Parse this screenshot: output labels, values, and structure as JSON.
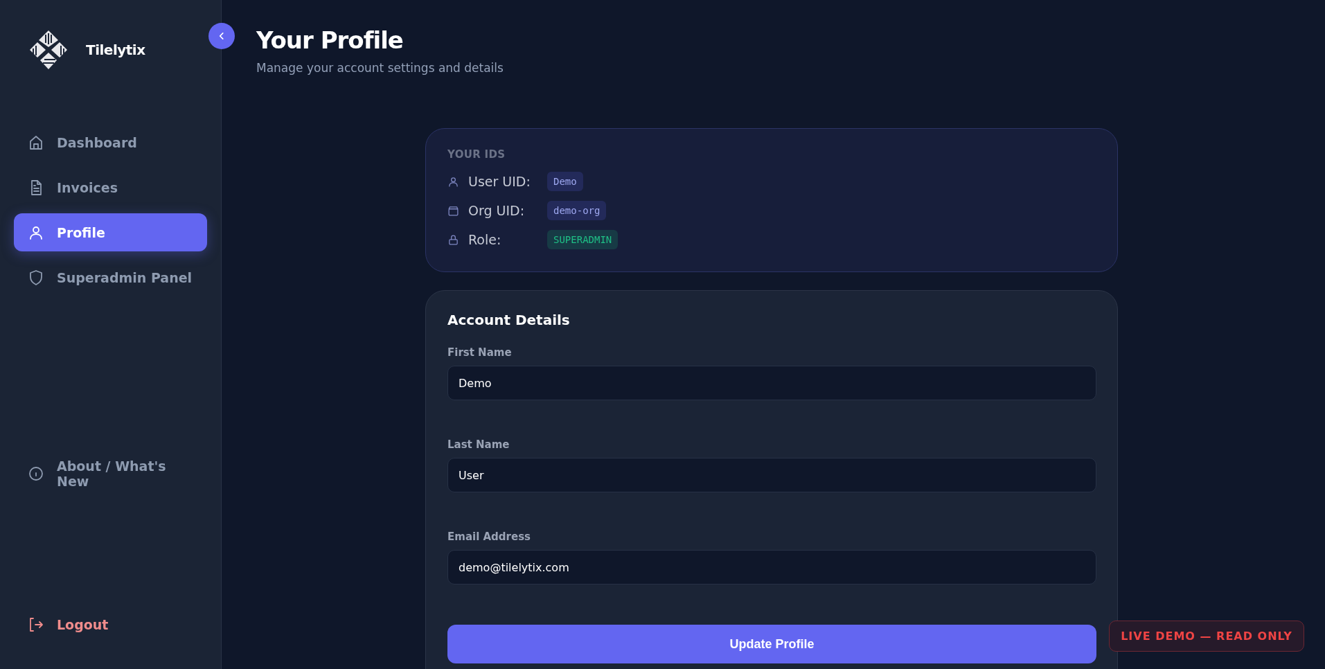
{
  "sidebar": {
    "brand": "Tilelytix",
    "items": [
      {
        "label": "Dashboard",
        "selected": false
      },
      {
        "label": "Invoices",
        "selected": false
      },
      {
        "label": "Profile",
        "selected": true
      },
      {
        "label": "Superadmin Panel",
        "selected": false
      }
    ],
    "footer_items": [
      {
        "label": "About / What's New"
      }
    ],
    "logout": {
      "label": "Logout"
    }
  },
  "header": {
    "title": "Your Profile",
    "subtitle": "Manage your account settings and details"
  },
  "ids_card": {
    "heading": "YOUR IDS",
    "rows": [
      {
        "label": "User UID:",
        "value": "Demo",
        "kind": "id"
      },
      {
        "label": "Org UID:",
        "value": "demo-org",
        "kind": "id"
      },
      {
        "label": "Role:",
        "value": "SUPERADMIN",
        "kind": "role"
      }
    ]
  },
  "account": {
    "heading": "Account Details",
    "fields": [
      {
        "label": "First Name",
        "value": "Demo"
      },
      {
        "label": "Last Name",
        "value": "User"
      },
      {
        "label": "Email Address",
        "value": "demo@tilelytix.com"
      }
    ],
    "submit": "Update Profile"
  },
  "demo_badge": "LIVE DEMO — READ ONLY"
}
